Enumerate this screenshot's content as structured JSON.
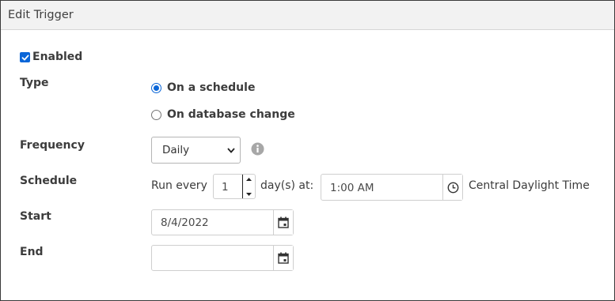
{
  "header": {
    "title": "Edit Trigger"
  },
  "enabled": {
    "label": "Enabled",
    "checked": true
  },
  "type": {
    "label": "Type",
    "options": [
      {
        "label": "On a schedule",
        "selected": true
      },
      {
        "label": "On database change",
        "selected": false
      }
    ]
  },
  "frequency": {
    "label": "Frequency",
    "value": "Daily"
  },
  "schedule": {
    "label": "Schedule",
    "run_every_prefix": "Run every",
    "interval": "1",
    "suffix": "day(s) at:",
    "time": "1:00 AM",
    "timezone": "Central Daylight Time"
  },
  "start": {
    "label": "Start",
    "value": "8/4/2022"
  },
  "end": {
    "label": "End",
    "value": ""
  },
  "colors": {
    "accent": "#0a66d8",
    "header_bg": "#f2f2f2"
  }
}
